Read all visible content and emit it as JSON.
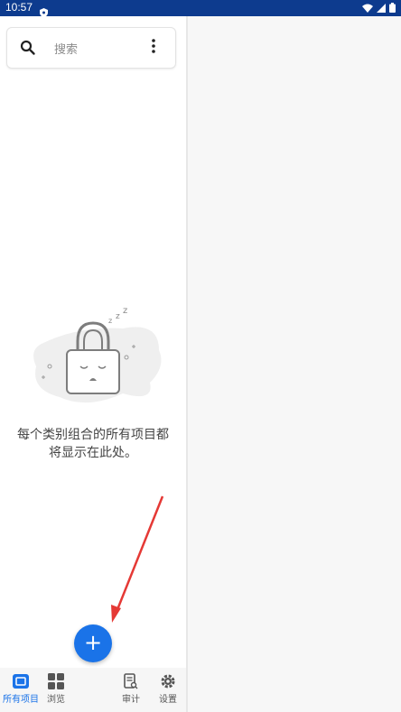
{
  "status_bar": {
    "time": "10:57"
  },
  "search": {
    "placeholder": "搜索"
  },
  "empty_state": {
    "line1": "每个类别组合的所有项目都",
    "line2": "将显示在此处。"
  },
  "fab": {
    "label": "+"
  },
  "bottom_nav": [
    {
      "label": "所有项目",
      "icon": "vault-icon",
      "active": true
    },
    {
      "label": "浏览",
      "icon": "grid-icon",
      "active": false
    },
    {
      "label": "审计",
      "icon": "audit-icon",
      "active": false
    },
    {
      "label": "设置",
      "icon": "gear-icon",
      "active": false
    }
  ],
  "colors": {
    "status_bar": "#0d3b8e",
    "accent": "#1a73e8",
    "annotation_arrow": "#e53935"
  }
}
